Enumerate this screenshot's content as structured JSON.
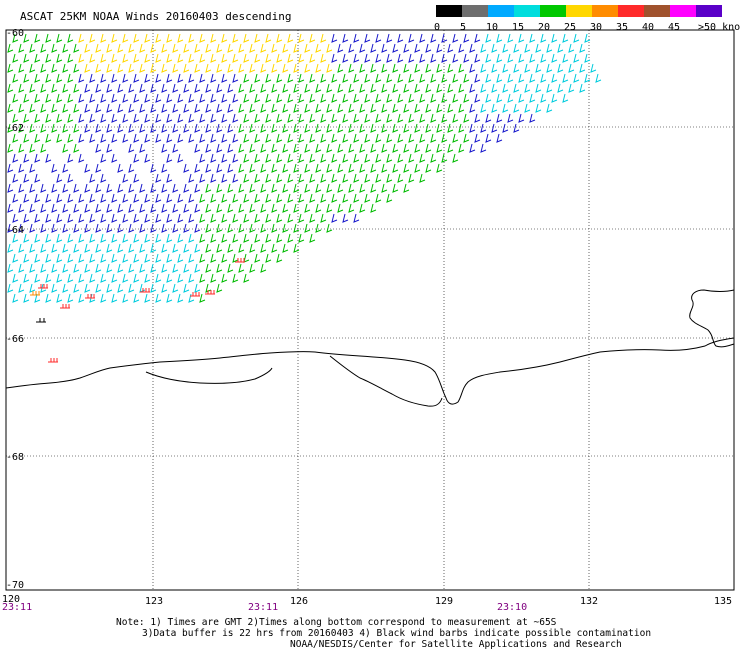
{
  "title": "ASCAT 25KM NOAA Winds 20160403 descending",
  "legend": {
    "labels": [
      "0",
      "5",
      "10",
      "15",
      "20",
      "25",
      "30",
      "35",
      "40",
      "45",
      ">50 knots"
    ],
    "colors": [
      "#000000",
      "#6e6e6e",
      "#00aaff",
      "#00dddd",
      "#00c800",
      "#ffd700",
      "#ff8c00",
      "#ff2a2a",
      "#a0522d",
      "#ff00ff",
      "#5a00c8"
    ]
  },
  "lat_ticks": [
    "-60",
    "-62",
    "-64",
    "-66",
    "-68",
    "-70"
  ],
  "lon_ticks": [
    "120",
    "123",
    "126",
    "129",
    "132",
    "135"
  ],
  "times": [
    "23:11",
    "23:11",
    "23:10"
  ],
  "notes": [
    "Note: 1) Times are GMT 2)Times along bottom correspond to measurement at ~65S",
    "3)Data buffer is 22 hrs from 20160403 4) Black wind barbs indicate possible contamination",
    "NOAA/NESDIS/Center for Satellite Applications and Research"
  ],
  "colors": {
    "background": "#ffffff",
    "grid": "#000000",
    "coast": "#000000",
    "time_label": "#800080"
  }
}
